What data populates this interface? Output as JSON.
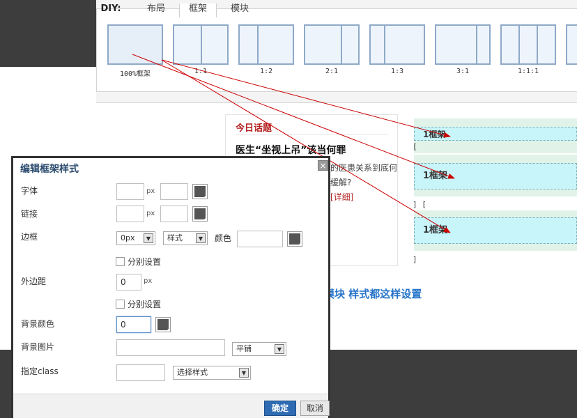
{
  "tabs": [
    {
      "label": "DIY:"
    },
    {
      "label": "布局"
    },
    {
      "label": "框架"
    },
    {
      "label": "模块"
    }
  ],
  "frame_options": [
    {
      "label": "100%框架"
    },
    {
      "label": "1:1"
    },
    {
      "label": "1:2"
    },
    {
      "label": "2:1"
    },
    {
      "label": "1:3"
    },
    {
      "label": "3:1"
    },
    {
      "label": "1:1:1"
    }
  ],
  "today": {
    "title": "今日话题",
    "headline": "医生“坐视上吊”该当何罪",
    "body": "的医患关系到底何缓解?",
    "more": "[详细]"
  },
  "frames": [
    {
      "label": "1框架",
      "bracket": "["
    },
    {
      "label": "1框架",
      "bracket": "] ["
    },
    {
      "label": "1框架",
      "bracket": "]"
    }
  ],
  "caption": "这是框架样式，所有的框架和模块 样式都这样设置",
  "dialog": {
    "title": "编辑框架样式",
    "close": "×",
    "font_label": "字体",
    "link_label": "链接",
    "border_label": "边框",
    "margin_label": "外边距",
    "bg_color_label": "背景颜色",
    "bg_image_label": "背景图片",
    "class_label": "指定class",
    "unit_px": "px",
    "border_width": "0px",
    "border_style": "样式",
    "color_label": "颜色",
    "separate_label": "分别设置",
    "margin_value": "0",
    "bg_color_value": "0",
    "repeat_value": "平铺",
    "class_select": "选择样式",
    "ok": "确定",
    "cancel": "取消"
  },
  "colors": {
    "accent": "#2574c9",
    "dialog_title": "#2b4b6e",
    "ok_button": "#2e6bb3",
    "frame_fill": "#c8f5fa",
    "arrow": "#cc0000"
  }
}
